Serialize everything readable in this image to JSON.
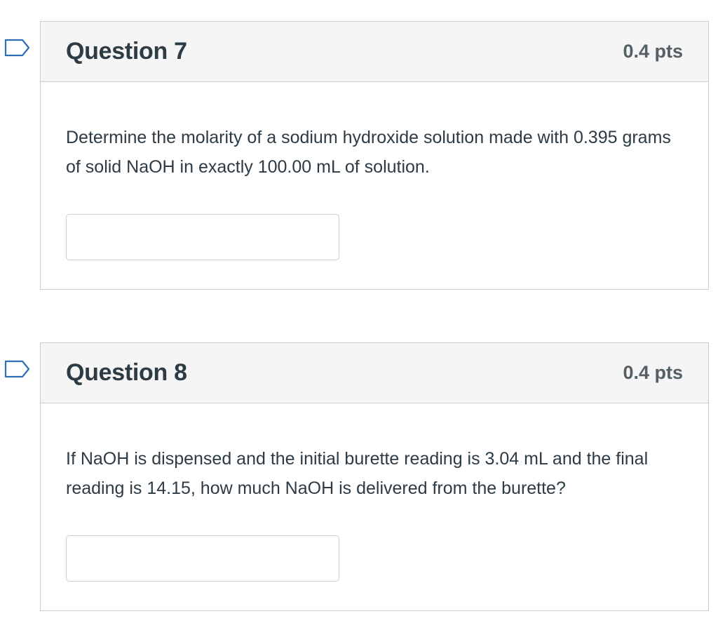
{
  "colors": {
    "border": "#c7cdd1",
    "header_bg": "#f5f5f5",
    "text": "#2d3b45",
    "points_text": "#555f66",
    "flag_stroke": "#2d6fb7"
  },
  "questions": [
    {
      "title": "Question 7",
      "points": "0.4 pts",
      "text": "Determine the molarity of a sodium hydroxide solution made with 0.395 grams of solid NaOH in exactly 100.00 mL of solution.",
      "answer_value": "",
      "flag_icon": "bookmark-flag-icon"
    },
    {
      "title": "Question 8",
      "points": "0.4 pts",
      "text": "If NaOH is dispensed and the initial burette reading is 3.04 mL and the final reading is 14.15, how much NaOH is delivered from the burette?",
      "answer_value": "",
      "flag_icon": "bookmark-flag-icon"
    }
  ]
}
